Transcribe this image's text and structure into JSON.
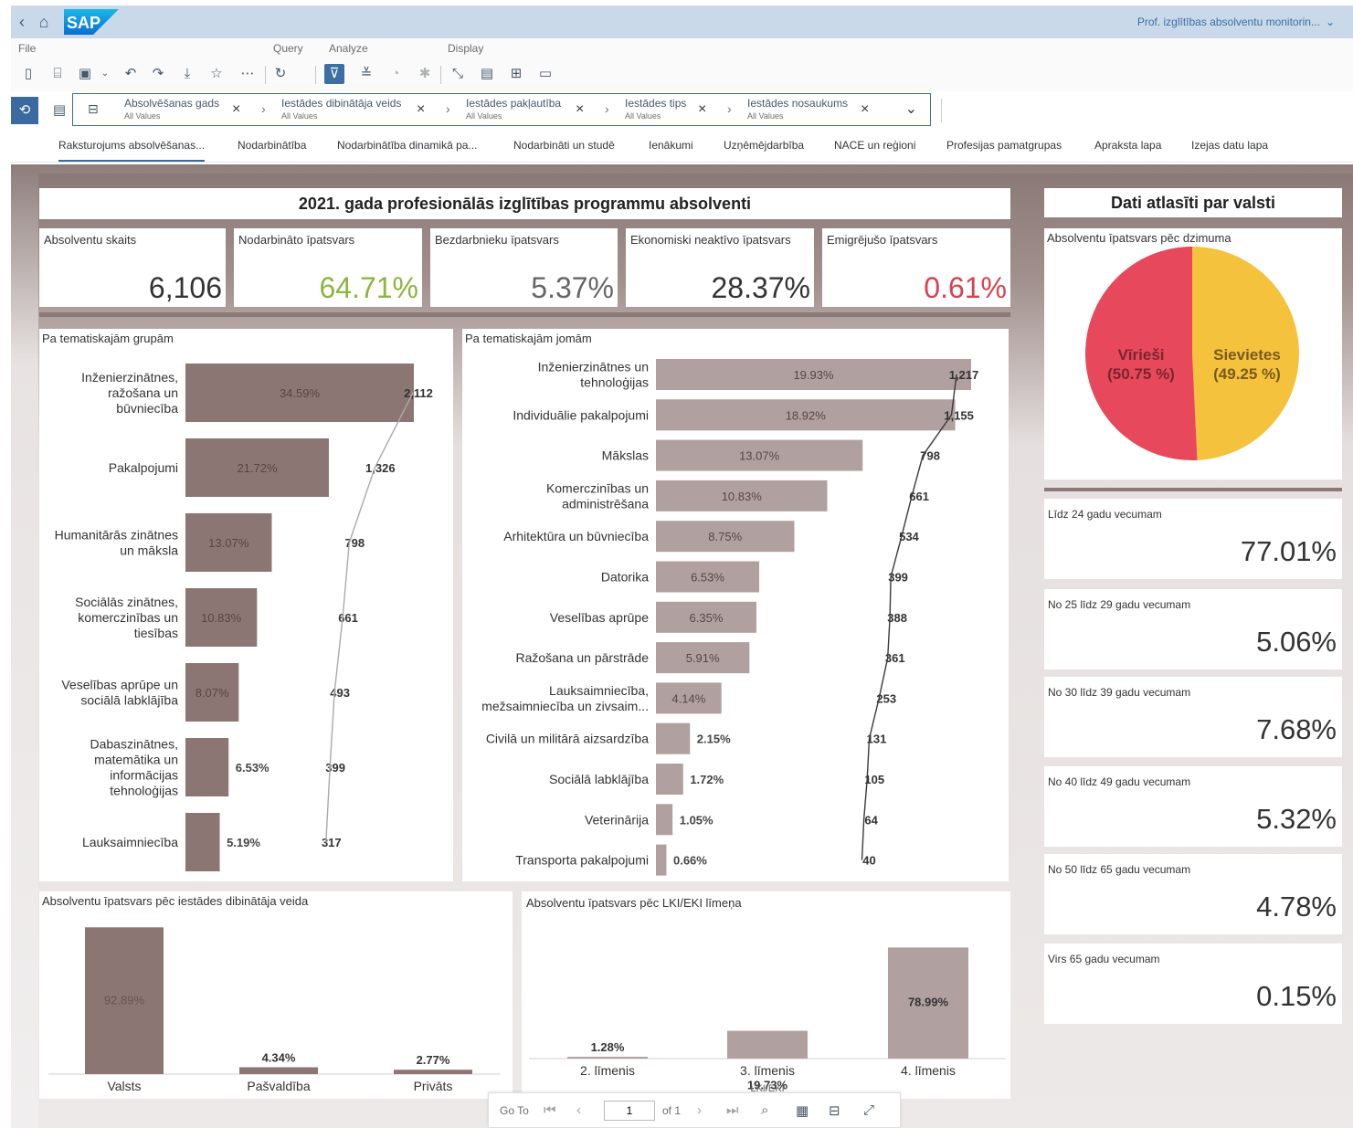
{
  "shell": {
    "logo": "SAP",
    "app_title": "Prof. izglītības absolventu monitorin...",
    "title_menu_icon": "chevron-down-icon"
  },
  "menu": {
    "file": "File",
    "query": "Query",
    "analyze": "Analyze",
    "display": "Display"
  },
  "filters": [
    {
      "label": "Absolvēšanas gads",
      "value": "All Values"
    },
    {
      "label": "Iestādes dibinātāja veids",
      "value": "All Values"
    },
    {
      "label": "Iestādes pakļautība",
      "value": "All Values"
    },
    {
      "label": "Iestādes tips",
      "value": "All Values"
    },
    {
      "label": "Iestādes nosaukums",
      "value": "All Values"
    }
  ],
  "tabs": [
    "Raksturojums absolvēšanas...",
    "Nodarbinātība",
    "Nodarbinātība dinamikā pa...",
    "Nodarbināti un studē",
    "Ienākumi",
    "Uzņēmējdarbība",
    "NACE un reģioni",
    "Profesijas pamatgrupas",
    "Apraksta lapa",
    "Izejas datu lapa"
  ],
  "main_title": "2021. gada profesionālās izglītības programmu absolventi",
  "kpis": [
    {
      "label": "Absolventu skaits",
      "value": "6,106",
      "color": "#333333"
    },
    {
      "label": "Nodarbināto īpatsvars",
      "value": "64.71%",
      "color": "#8db53f"
    },
    {
      "label": "Bezdarbnieku īpatsvars",
      "value": "5.37%",
      "color": "#666666"
    },
    {
      "label": "Ekonomiski neaktīvo īpatsvars",
      "value": "28.37%",
      "color": "#333333"
    },
    {
      "label": "Emigrējušo īpatsvars",
      "value": "0.61%",
      "color": "#d9414f"
    }
  ],
  "country_title": "Dati atlasīti par valsti",
  "chart_data": [
    {
      "type": "bar",
      "title": "Pa tematiskajām grupām",
      "categories": [
        "Inženierzinātnes, ražošana un būvniecība",
        "Pakalpojumi",
        "Humanitārās zinātnes un māksla",
        "Sociālās zinātnes, komerczinības un tiesības",
        "Veselības aprūpe un sociālā labklājība",
        "Dabaszinātnes, matemātika un informācijas tehnoloģijas",
        "Lauksaimniecība"
      ],
      "category_lines": [
        [
          "Inženierzinātnes,",
          "ražošana un",
          "būvniecība"
        ],
        [
          "Pakalpojumi"
        ],
        [
          "Humanitārās zinātnes",
          "un māksla"
        ],
        [
          "Sociālās zinātnes,",
          "komerczinības un",
          "tiesības"
        ],
        [
          "Veselības aprūpe un",
          "sociālā labklājība"
        ],
        [
          "Dabaszinātnes,",
          "matemātika un",
          "informācijas",
          "tehnoloģijas"
        ],
        [
          "Lauksaimniecība"
        ]
      ],
      "series": [
        {
          "name": "Īpatsvars",
          "values": [
            34.59,
            21.72,
            13.07,
            10.83,
            8.07,
            6.53,
            5.19
          ],
          "labels": [
            "34.59%",
            "21.72%",
            "13.07%",
            "10.83%",
            "8.07%",
            "6.53%",
            "5.19%"
          ]
        },
        {
          "name": "Skaits",
          "values": [
            2112,
            1326,
            798,
            661,
            493,
            399,
            317
          ],
          "labels": [
            "2,112",
            "1,326",
            "798",
            "661",
            "493",
            "399",
            "317"
          ]
        }
      ],
      "orientation": "horizontal",
      "color": "#8c7673"
    },
    {
      "type": "bar",
      "title": "Pa tematiskajām jomām",
      "categories": [
        "Inženierzinātnes un tehnoloģijas",
        "Individuālie pakalpojumi",
        "Mākslas",
        "Komerczinības un administrēšana",
        "Arhitektūra un būvniecība",
        "Datorika",
        "Veselības aprūpe",
        "Ražošana un pārstrāde",
        "Lauksaimniecība, mežsaimniecība un zivsaim...",
        "Civilā un militārā aizsardzība",
        "Sociālā labklājība",
        "Veterinārija",
        "Transporta pakalpojumi"
      ],
      "category_lines": [
        [
          "Inženierzinātnes un",
          "tehnoloģijas"
        ],
        [
          "Individuālie pakalpojumi"
        ],
        [
          "Mākslas"
        ],
        [
          "Komerczinības un",
          "administrēšana"
        ],
        [
          "Arhitektūra un būvniecība"
        ],
        [
          "Datorika"
        ],
        [
          "Veselības aprūpe"
        ],
        [
          "Ražošana un pārstrāde"
        ],
        [
          "Lauksaimniecība,",
          "mežsaimniecība un zivsaim..."
        ],
        [
          "Civilā un militārā aizsardzība"
        ],
        [
          "Sociālā labklājība"
        ],
        [
          "Veterinārija"
        ],
        [
          "Transporta pakalpojumi"
        ]
      ],
      "series": [
        {
          "name": "Īpatsvars",
          "values": [
            19.93,
            18.92,
            13.07,
            10.83,
            8.75,
            6.53,
            6.35,
            5.91,
            4.14,
            2.15,
            1.72,
            1.05,
            0.66
          ],
          "labels": [
            "19.93%",
            "18.92%",
            "13.07%",
            "10.83%",
            "8.75%",
            "6.53%",
            "6.35%",
            "5.91%",
            "4.14%",
            "2.15%",
            "1.72%",
            "1.05%",
            "0.66%"
          ]
        },
        {
          "name": "Skaits",
          "values": [
            1217,
            1155,
            798,
            661,
            534,
            399,
            388,
            361,
            253,
            131,
            105,
            64,
            40
          ],
          "labels": [
            "1,217",
            "1,155",
            "798",
            "661",
            "534",
            "399",
            "388",
            "361",
            "253",
            "131",
            "105",
            "64",
            "40"
          ]
        }
      ],
      "orientation": "horizontal",
      "color": "#b0a1a0"
    },
    {
      "type": "pie",
      "title": "Absolventu īpatsvars pēc dzimuma",
      "categories": [
        "Vīrieši",
        "Sievietes"
      ],
      "values": [
        50.75,
        49.25
      ],
      "labels": [
        "(50.75 %)",
        "(49.25 %)"
      ],
      "colors": [
        "#e8485b",
        "#f4c23c"
      ]
    },
    {
      "type": "bar",
      "title": "Absolventu īpatsvars pēc iestādes dibinātāja veida",
      "categories": [
        "Valsts",
        "Pašvaldība",
        "Privāts"
      ],
      "values": [
        92.89,
        4.34,
        2.77
      ],
      "labels": [
        "92.89%",
        "4.34%",
        "2.77%"
      ],
      "color": "#8c7673"
    },
    {
      "type": "bar",
      "title": "Absolventu īpatsvars pēc LKI/EKI līmeņa",
      "categories": [
        "2. līmenis",
        "3. līmenis",
        "4. līmenis"
      ],
      "values": [
        1.28,
        19.73,
        78.99
      ],
      "labels": [
        "1.28%",
        "19.73%",
        "78.99%"
      ],
      "xlabel": "LKI/EKI",
      "color": "#b0a1a0"
    }
  ],
  "ages": [
    {
      "label": "Līdz 24 gadu vecumam",
      "value": "77.01%"
    },
    {
      "label": "No 25 līdz 29 gadu vecumam",
      "value": "5.06%"
    },
    {
      "label": "No 30 līdz 39 gadu vecumam",
      "value": "7.68%"
    },
    {
      "label": "No 40 līdz 49 gadu vecumam",
      "value": "5.32%"
    },
    {
      "label": "No 50 līdz 65 gadu vecumam",
      "value": "4.78%"
    },
    {
      "label": "Virs 65 gadu vecumam",
      "value": "0.15%"
    }
  ],
  "pager": {
    "goto": "Go To",
    "page": "1",
    "of": "of 1"
  }
}
